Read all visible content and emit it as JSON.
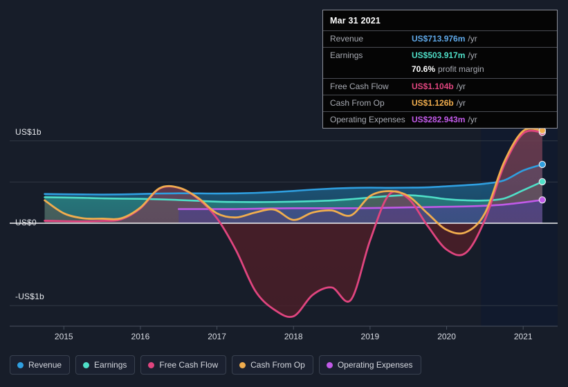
{
  "chart_data": {
    "type": "area",
    "title": "",
    "xlabel": "",
    "ylabel": "",
    "ylim": [
      -1250,
      1250
    ],
    "xlim": [
      2014.6,
      2021.45
    ],
    "grid": true,
    "legend_position": "bottom-left",
    "y_ticks": [
      {
        "value": 1000,
        "label": "US$1b"
      },
      {
        "value": 0,
        "label": "US$0"
      },
      {
        "value": -1000,
        "label": "-US$1b"
      }
    ],
    "y_gridlines": [
      1000,
      500,
      0,
      -1000
    ],
    "x_ticks": [
      {
        "value": 2015,
        "label": "2015"
      },
      {
        "value": 2016,
        "label": "2016"
      },
      {
        "value": 2017,
        "label": "2017"
      },
      {
        "value": 2018,
        "label": "2018"
      },
      {
        "value": 2019,
        "label": "2019"
      },
      {
        "value": 2020,
        "label": "2020"
      },
      {
        "value": 2021,
        "label": "2021"
      }
    ],
    "units": "US$ millions",
    "forecast_start": 2020.45,
    "x": [
      2014.75,
      2015.0,
      2015.25,
      2015.5,
      2015.75,
      2016.0,
      2016.25,
      2016.5,
      2016.75,
      2017.0,
      2017.25,
      2017.5,
      2017.75,
      2018.0,
      2018.25,
      2018.5,
      2018.75,
      2019.0,
      2019.25,
      2019.5,
      2019.75,
      2020.0,
      2020.25,
      2020.5,
      2020.75,
      2021.0,
      2021.25
    ],
    "series": [
      {
        "name": "Revenue",
        "color": "#2f9fe0",
        "fill": "#1d5f86",
        "values": [
          355,
          352,
          350,
          348,
          350,
          355,
          360,
          363,
          362,
          360,
          362,
          368,
          378,
          392,
          408,
          420,
          428,
          432,
          430,
          432,
          436,
          448,
          462,
          480,
          520,
          640,
          714
        ],
        "end_value": 714,
        "end_label": "US$713.976m"
      },
      {
        "name": "Earnings",
        "color": "#4fdfc8",
        "fill": "#2a7f7c",
        "values": [
          315,
          312,
          308,
          302,
          298,
          296,
          290,
          282,
          272,
          262,
          258,
          256,
          258,
          262,
          268,
          276,
          292,
          312,
          330,
          340,
          322,
          292,
          278,
          276,
          300,
          400,
          504
        ],
        "end_value": 504,
        "end_label": "US$503.917m"
      },
      {
        "name": "Free Cash Flow",
        "color": "#e0457f",
        "fill_pos": "#7a3a60",
        "fill_neg": "#4b1e28",
        "values": [
          30,
          25,
          22,
          28,
          48,
          180,
          420,
          430,
          300,
          60,
          -330,
          -820,
          -1050,
          -1130,
          -870,
          -780,
          -930,
          -210,
          350,
          300,
          -30,
          -320,
          -360,
          40,
          700,
          1090,
          1104
        ],
        "end_value": 1104,
        "end_label": "US$1.104b"
      },
      {
        "name": "Cash From Op",
        "color": "#f0ad4e",
        "fill": "#6e4c3e",
        "values": [
          278,
          120,
          60,
          55,
          60,
          190,
          425,
          432,
          310,
          120,
          70,
          130,
          165,
          40,
          130,
          155,
          95,
          330,
          390,
          330,
          120,
          -80,
          -110,
          120,
          740,
          1120,
          1126
        ],
        "end_value": 1126,
        "end_label": "US$1.126b"
      },
      {
        "name": "Operating Expenses",
        "color": "#c15ae8",
        "fill": "#4a3f8e",
        "values": [
          null,
          null,
          null,
          null,
          null,
          null,
          null,
          172,
          172,
          172,
          172,
          176,
          180,
          182,
          182,
          182,
          182,
          184,
          188,
          192,
          196,
          200,
          204,
          212,
          226,
          252,
          283
        ],
        "end_value": 283,
        "end_label": "US$282.943m"
      }
    ]
  },
  "tooltip": {
    "date": "Mar 31 2021",
    "rows": [
      {
        "label": "Revenue",
        "value": "US$713.976m",
        "unit": "/yr",
        "color": "#5fa8e8"
      },
      {
        "label": "Earnings",
        "value": "US$503.917m",
        "unit": "/yr",
        "color": "#4fdfc8"
      },
      {
        "label": "Free Cash Flow",
        "value": "US$1.104b",
        "unit": "/yr",
        "color": "#e0457f"
      },
      {
        "label": "Cash From Op",
        "value": "US$1.126b",
        "unit": "/yr",
        "color": "#f0ad4e"
      },
      {
        "label": "Operating Expenses",
        "value": "US$282.943m",
        "unit": "/yr",
        "color": "#c15ae8"
      }
    ],
    "profit_margin_value": "70.6%",
    "profit_margin_text": "profit margin"
  },
  "legend": {
    "items": [
      {
        "label": "Revenue",
        "color": "#2f9fe0"
      },
      {
        "label": "Earnings",
        "color": "#4fdfc8"
      },
      {
        "label": "Free Cash Flow",
        "color": "#e0457f"
      },
      {
        "label": "Cash From Op",
        "color": "#f0ad4e"
      },
      {
        "label": "Operating Expenses",
        "color": "#c15ae8"
      }
    ]
  },
  "theme": {
    "background": "#171d29",
    "grid": "#3a414e",
    "zero_line": "#ffffff",
    "forecast_band": "#101a2e"
  }
}
